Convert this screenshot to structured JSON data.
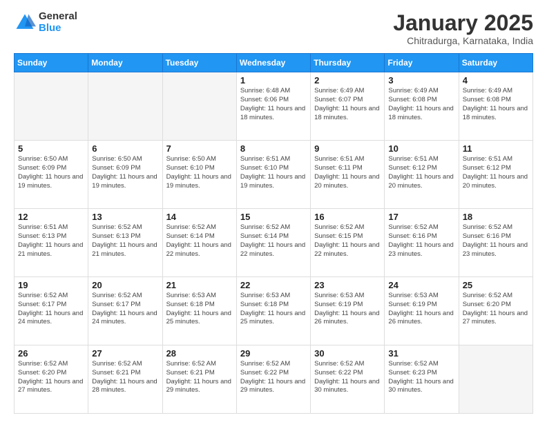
{
  "logo": {
    "general": "General",
    "blue": "Blue"
  },
  "header": {
    "month": "January 2025",
    "location": "Chitradurga, Karnataka, India"
  },
  "weekdays": [
    "Sunday",
    "Monday",
    "Tuesday",
    "Wednesday",
    "Thursday",
    "Friday",
    "Saturday"
  ],
  "weeks": [
    [
      {
        "day": "",
        "info": ""
      },
      {
        "day": "",
        "info": ""
      },
      {
        "day": "",
        "info": ""
      },
      {
        "day": "1",
        "info": "Sunrise: 6:48 AM\nSunset: 6:06 PM\nDaylight: 11 hours and 18 minutes."
      },
      {
        "day": "2",
        "info": "Sunrise: 6:49 AM\nSunset: 6:07 PM\nDaylight: 11 hours and 18 minutes."
      },
      {
        "day": "3",
        "info": "Sunrise: 6:49 AM\nSunset: 6:08 PM\nDaylight: 11 hours and 18 minutes."
      },
      {
        "day": "4",
        "info": "Sunrise: 6:49 AM\nSunset: 6:08 PM\nDaylight: 11 hours and 18 minutes."
      }
    ],
    [
      {
        "day": "5",
        "info": "Sunrise: 6:50 AM\nSunset: 6:09 PM\nDaylight: 11 hours and 19 minutes."
      },
      {
        "day": "6",
        "info": "Sunrise: 6:50 AM\nSunset: 6:09 PM\nDaylight: 11 hours and 19 minutes."
      },
      {
        "day": "7",
        "info": "Sunrise: 6:50 AM\nSunset: 6:10 PM\nDaylight: 11 hours and 19 minutes."
      },
      {
        "day": "8",
        "info": "Sunrise: 6:51 AM\nSunset: 6:10 PM\nDaylight: 11 hours and 19 minutes."
      },
      {
        "day": "9",
        "info": "Sunrise: 6:51 AM\nSunset: 6:11 PM\nDaylight: 11 hours and 20 minutes."
      },
      {
        "day": "10",
        "info": "Sunrise: 6:51 AM\nSunset: 6:12 PM\nDaylight: 11 hours and 20 minutes."
      },
      {
        "day": "11",
        "info": "Sunrise: 6:51 AM\nSunset: 6:12 PM\nDaylight: 11 hours and 20 minutes."
      }
    ],
    [
      {
        "day": "12",
        "info": "Sunrise: 6:51 AM\nSunset: 6:13 PM\nDaylight: 11 hours and 21 minutes."
      },
      {
        "day": "13",
        "info": "Sunrise: 6:52 AM\nSunset: 6:13 PM\nDaylight: 11 hours and 21 minutes."
      },
      {
        "day": "14",
        "info": "Sunrise: 6:52 AM\nSunset: 6:14 PM\nDaylight: 11 hours and 22 minutes."
      },
      {
        "day": "15",
        "info": "Sunrise: 6:52 AM\nSunset: 6:14 PM\nDaylight: 11 hours and 22 minutes."
      },
      {
        "day": "16",
        "info": "Sunrise: 6:52 AM\nSunset: 6:15 PM\nDaylight: 11 hours and 22 minutes."
      },
      {
        "day": "17",
        "info": "Sunrise: 6:52 AM\nSunset: 6:16 PM\nDaylight: 11 hours and 23 minutes."
      },
      {
        "day": "18",
        "info": "Sunrise: 6:52 AM\nSunset: 6:16 PM\nDaylight: 11 hours and 23 minutes."
      }
    ],
    [
      {
        "day": "19",
        "info": "Sunrise: 6:52 AM\nSunset: 6:17 PM\nDaylight: 11 hours and 24 minutes."
      },
      {
        "day": "20",
        "info": "Sunrise: 6:52 AM\nSunset: 6:17 PM\nDaylight: 11 hours and 24 minutes."
      },
      {
        "day": "21",
        "info": "Sunrise: 6:53 AM\nSunset: 6:18 PM\nDaylight: 11 hours and 25 minutes."
      },
      {
        "day": "22",
        "info": "Sunrise: 6:53 AM\nSunset: 6:18 PM\nDaylight: 11 hours and 25 minutes."
      },
      {
        "day": "23",
        "info": "Sunrise: 6:53 AM\nSunset: 6:19 PM\nDaylight: 11 hours and 26 minutes."
      },
      {
        "day": "24",
        "info": "Sunrise: 6:53 AM\nSunset: 6:19 PM\nDaylight: 11 hours and 26 minutes."
      },
      {
        "day": "25",
        "info": "Sunrise: 6:52 AM\nSunset: 6:20 PM\nDaylight: 11 hours and 27 minutes."
      }
    ],
    [
      {
        "day": "26",
        "info": "Sunrise: 6:52 AM\nSunset: 6:20 PM\nDaylight: 11 hours and 27 minutes."
      },
      {
        "day": "27",
        "info": "Sunrise: 6:52 AM\nSunset: 6:21 PM\nDaylight: 11 hours and 28 minutes."
      },
      {
        "day": "28",
        "info": "Sunrise: 6:52 AM\nSunset: 6:21 PM\nDaylight: 11 hours and 29 minutes."
      },
      {
        "day": "29",
        "info": "Sunrise: 6:52 AM\nSunset: 6:22 PM\nDaylight: 11 hours and 29 minutes."
      },
      {
        "day": "30",
        "info": "Sunrise: 6:52 AM\nSunset: 6:22 PM\nDaylight: 11 hours and 30 minutes."
      },
      {
        "day": "31",
        "info": "Sunrise: 6:52 AM\nSunset: 6:23 PM\nDaylight: 11 hours and 30 minutes."
      },
      {
        "day": "",
        "info": ""
      }
    ]
  ]
}
